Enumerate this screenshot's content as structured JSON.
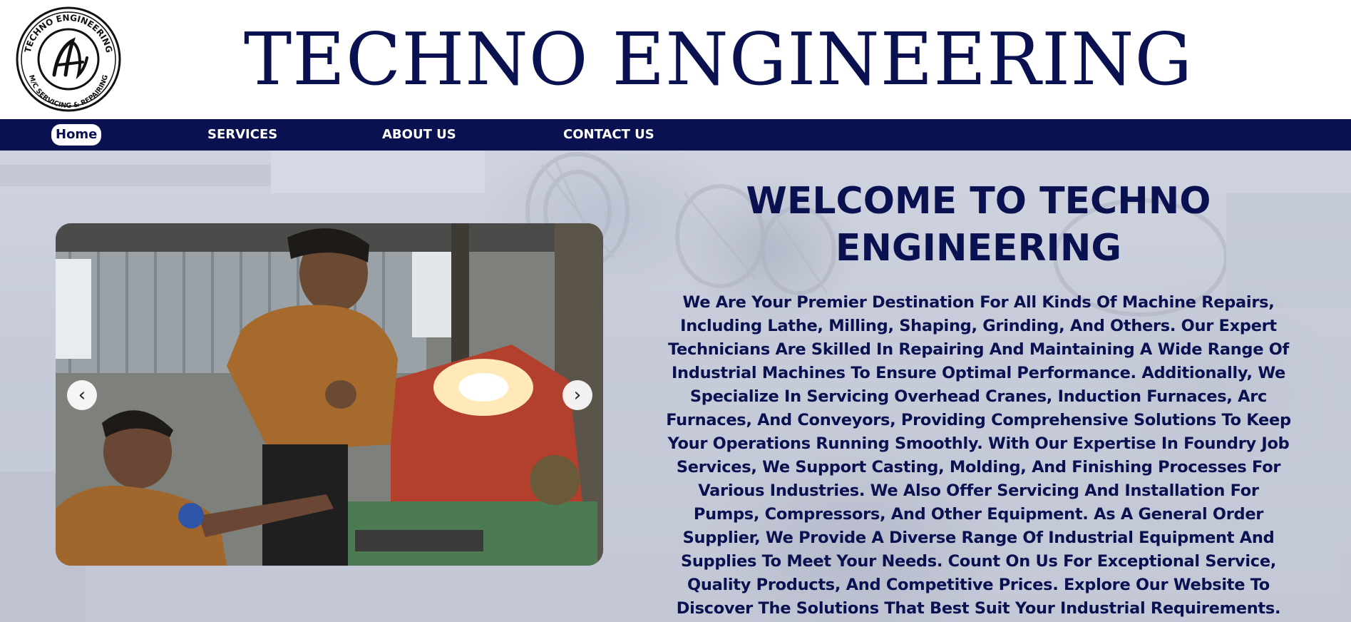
{
  "brand": {
    "title": "TECHNO ENGINEERING",
    "logo_ring_text_top": "TECHNO ENGINEERING",
    "logo_ring_text_bottom": "M/C SERVICING & REPAIRING",
    "primary_color": "#0a1150"
  },
  "nav": {
    "items": [
      {
        "label": "Home",
        "active": true
      },
      {
        "label": "SERVICES",
        "active": false
      },
      {
        "label": "ABOUT US",
        "active": false
      },
      {
        "label": "CONTACT US",
        "active": false
      }
    ]
  },
  "carousel": {
    "prev_icon": "chevron-left-icon",
    "next_icon": "chevron-right-icon"
  },
  "welcome": {
    "title_line1": "WELCOME TO TECHNO",
    "title_line2": "ENGINEERING",
    "body": "We Are Your Premier Destination For All Kinds Of Machine Repairs, Including Lathe, Milling, Shaping, Grinding, And Others. Our Expert Technicians Are Skilled In Repairing And Maintaining A Wide Range Of Industrial Machines To Ensure Optimal Performance. Additionally, We Specialize In Servicing Overhead Cranes, Induction Furnaces, Arc Furnaces, And Conveyors, Providing Comprehensive Solutions To Keep Your Operations Running Smoothly. With Our Expertise In Foundry Job Services, We Support Casting, Molding, And Finishing Processes For Various Industries. We Also Offer Servicing And Installation For Pumps, Compressors, And Other Equipment. As A General Order Supplier, We Provide A Diverse Range Of Industrial Equipment And Supplies To Meet Your Needs. Count On Us For Exceptional Service, Quality Products, And Competitive Prices. Explore Our Website To Discover The Solutions That Best Suit Your Industrial Requirements."
  }
}
